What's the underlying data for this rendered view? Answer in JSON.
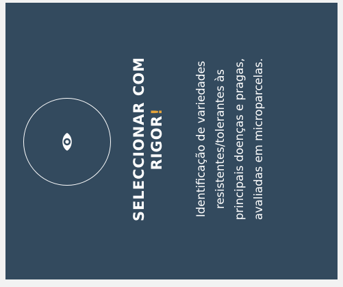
{
  "card": {
    "icon": "eye-icon",
    "title_line1": "SELECCIONAR COM",
    "title_line2": "RIGOR",
    "title_exclamation": "!",
    "description_line1": "Identificação de variedades",
    "description_line2": "resistentes/tolerantes às",
    "description_line3": "principais doenças e pragas,",
    "description_line4": "avaliadas em microparcelas.",
    "colors": {
      "background": "#334a5e",
      "text": "#ffffff",
      "accent": "#e6a43a"
    }
  }
}
